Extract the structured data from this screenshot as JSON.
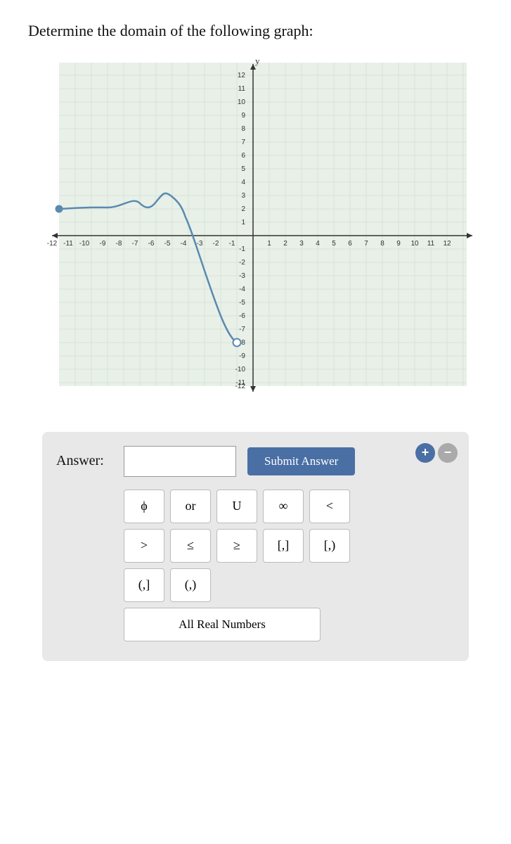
{
  "question": {
    "title": "Determine the domain of the following graph:"
  },
  "answer": {
    "label": "Answer:",
    "input_placeholder": "",
    "submit_label": "Submit Answer"
  },
  "controls": {
    "plus_label": "+",
    "minus_label": "−"
  },
  "keypad": {
    "row1": [
      {
        "label": "ϕ",
        "name": "phi"
      },
      {
        "label": "or",
        "name": "or"
      },
      {
        "label": "U",
        "name": "union"
      },
      {
        "label": "∞",
        "name": "infinity"
      },
      {
        "label": "<",
        "name": "less-than"
      }
    ],
    "row2": [
      {
        "label": ">",
        "name": "greater-than"
      },
      {
        "label": "≤",
        "name": "less-equal"
      },
      {
        "label": "≥",
        "name": "greater-equal"
      },
      {
        "label": "[,]",
        "name": "closed-interval"
      },
      {
        "label": "[,)",
        "name": "half-open-right"
      }
    ],
    "row3": [
      {
        "label": "(,]",
        "name": "half-open-left"
      },
      {
        "label": "(,)",
        "name": "open-interval"
      }
    ],
    "row4": [
      {
        "label": "All Real Numbers",
        "name": "all-real-numbers"
      }
    ]
  }
}
